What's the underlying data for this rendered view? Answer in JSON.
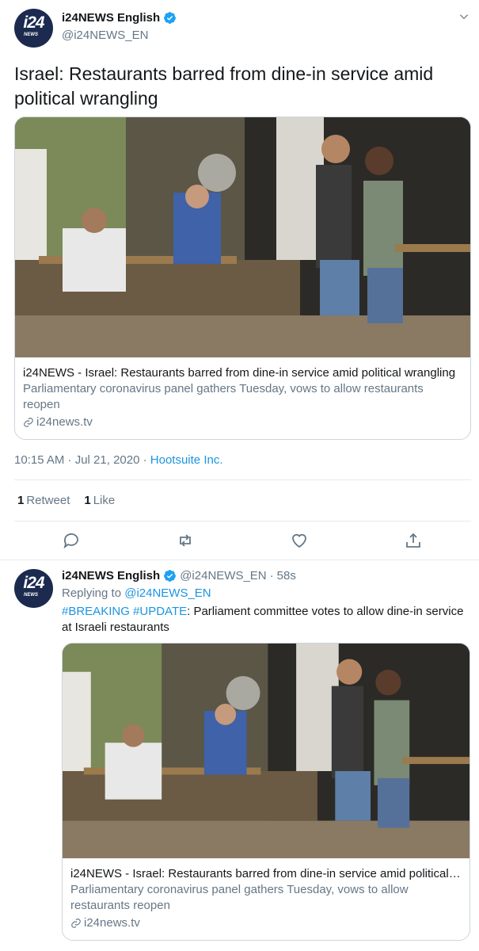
{
  "main_tweet": {
    "display_name": "i24NEWS English",
    "handle": "@i24NEWS_EN",
    "avatar_text": "i24",
    "avatar_sub": "NEWS",
    "text": "Israel: Restaurants barred from dine-in service amid political wrangling",
    "card": {
      "title": "i24NEWS - Israel: Restaurants barred from dine-in service amid political wrangling",
      "description": "Parliamentary coronavirus panel gathers Tuesday, vows to allow restaurants reopen",
      "domain": "i24news.tv"
    },
    "time": "10:15 AM · Jul 21, 2020 · ",
    "source": "Hootsuite Inc.",
    "retweets_count": "1",
    "retweets_label": "Retweet",
    "likes_count": "1",
    "likes_label": "Like"
  },
  "reply_tweet": {
    "display_name": "i24NEWS English",
    "handle": "@i24NEWS_EN",
    "sep": "·",
    "age": "58s",
    "replying_prefix": "Replying to ",
    "replying_to": "@i24NEWS_EN",
    "tag1": "#BREAKING",
    "tag2": "#UPDATE",
    "text": ": Parliament committee votes to allow dine-in service at Israeli restaurants",
    "card": {
      "title": "i24NEWS - Israel: Restaurants barred from dine-in service amid political ...",
      "description": "Parliamentary coronavirus panel gathers Tuesday, vows to allow restaurants reopen",
      "domain": "i24news.tv"
    }
  },
  "colors": {
    "link": "#1b95e0",
    "verified": "#1da1f2",
    "muted": "#657786",
    "avatar_bg": "#1b2a4e"
  },
  "icons": [
    "chevron-down-icon",
    "verified-icon",
    "link-icon",
    "reply-icon",
    "retweet-icon",
    "like-icon",
    "share-icon"
  ]
}
